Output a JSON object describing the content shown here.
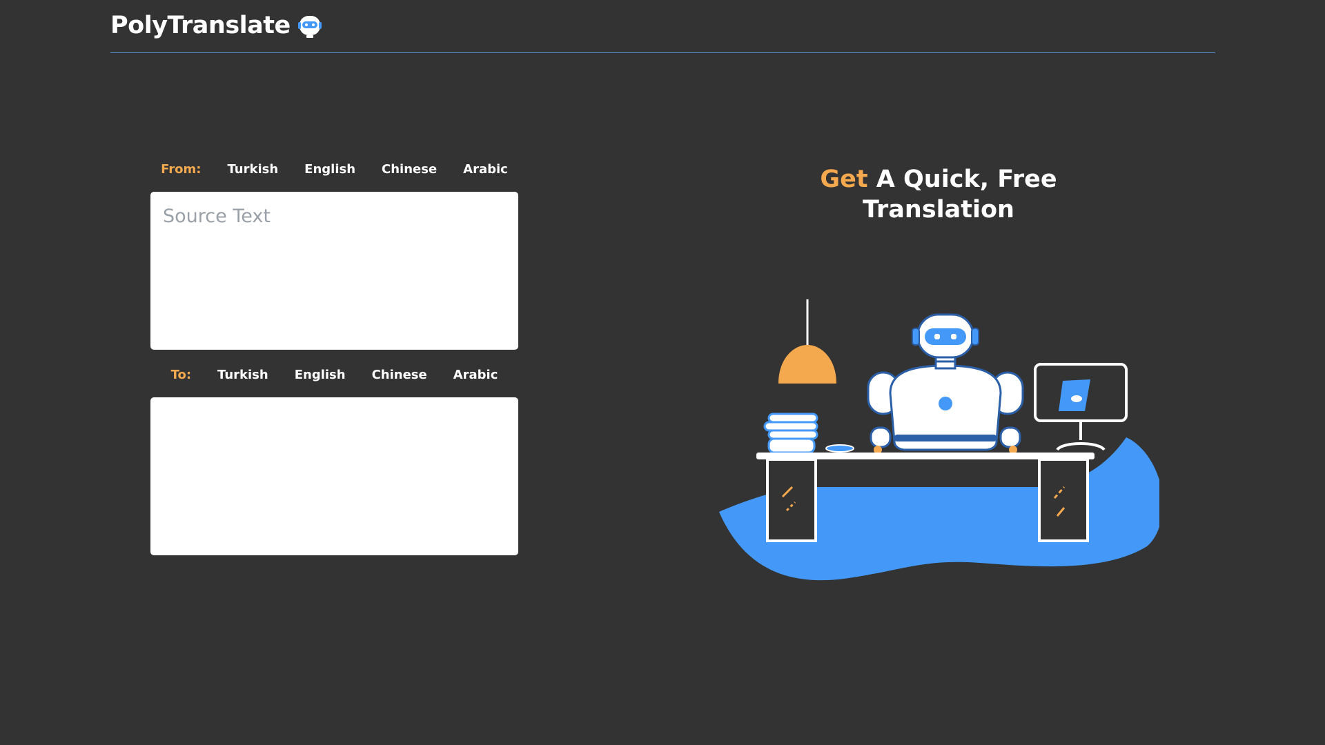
{
  "header": {
    "brand_name": "PolyTranslate",
    "brand_icon": "robot-head-icon"
  },
  "source": {
    "label": "From:",
    "languages": [
      "Turkish",
      "English",
      "Chinese",
      "Arabic"
    ],
    "placeholder": "Source Text",
    "value": ""
  },
  "target": {
    "label": "To:",
    "languages": [
      "Turkish",
      "English",
      "Chinese",
      "Arabic"
    ],
    "value": ""
  },
  "hero": {
    "title_accent": "Get",
    "title_rest_line1": "A Quick, Free",
    "title_line2": "Translation",
    "illustration": "robot-at-desk-illustration"
  },
  "colors": {
    "background": "#333333",
    "accent": "#f5a94f",
    "blue": "#4499f8",
    "divider": "#5b8fd6"
  }
}
